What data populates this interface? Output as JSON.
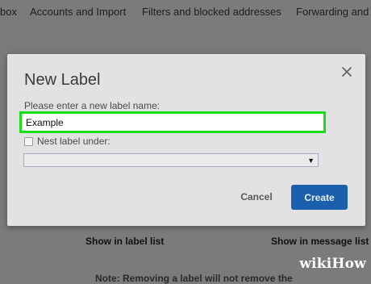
{
  "background": {
    "tabs": [
      "box",
      "Accounts and Import",
      "Filters and blocked addresses",
      "Forwarding and"
    ],
    "columns": [
      "Show in label list",
      "Show in message list"
    ],
    "note": "Note: Removing a label will not remove the"
  },
  "dialog": {
    "title": "New Label",
    "close_icon": "close-icon",
    "name_prompt": "Please enter a new label name:",
    "name_value": "Example",
    "nest_label": "Nest label under:",
    "nest_checked": false,
    "parent_selected": "",
    "cancel_label": "Cancel",
    "create_label": "Create"
  },
  "watermark": {
    "part1": "wiki",
    "part2": "How"
  },
  "colors": {
    "highlight": "#19df19",
    "primary_button": "#1a60ad",
    "overlay": "#7b7b7b"
  }
}
